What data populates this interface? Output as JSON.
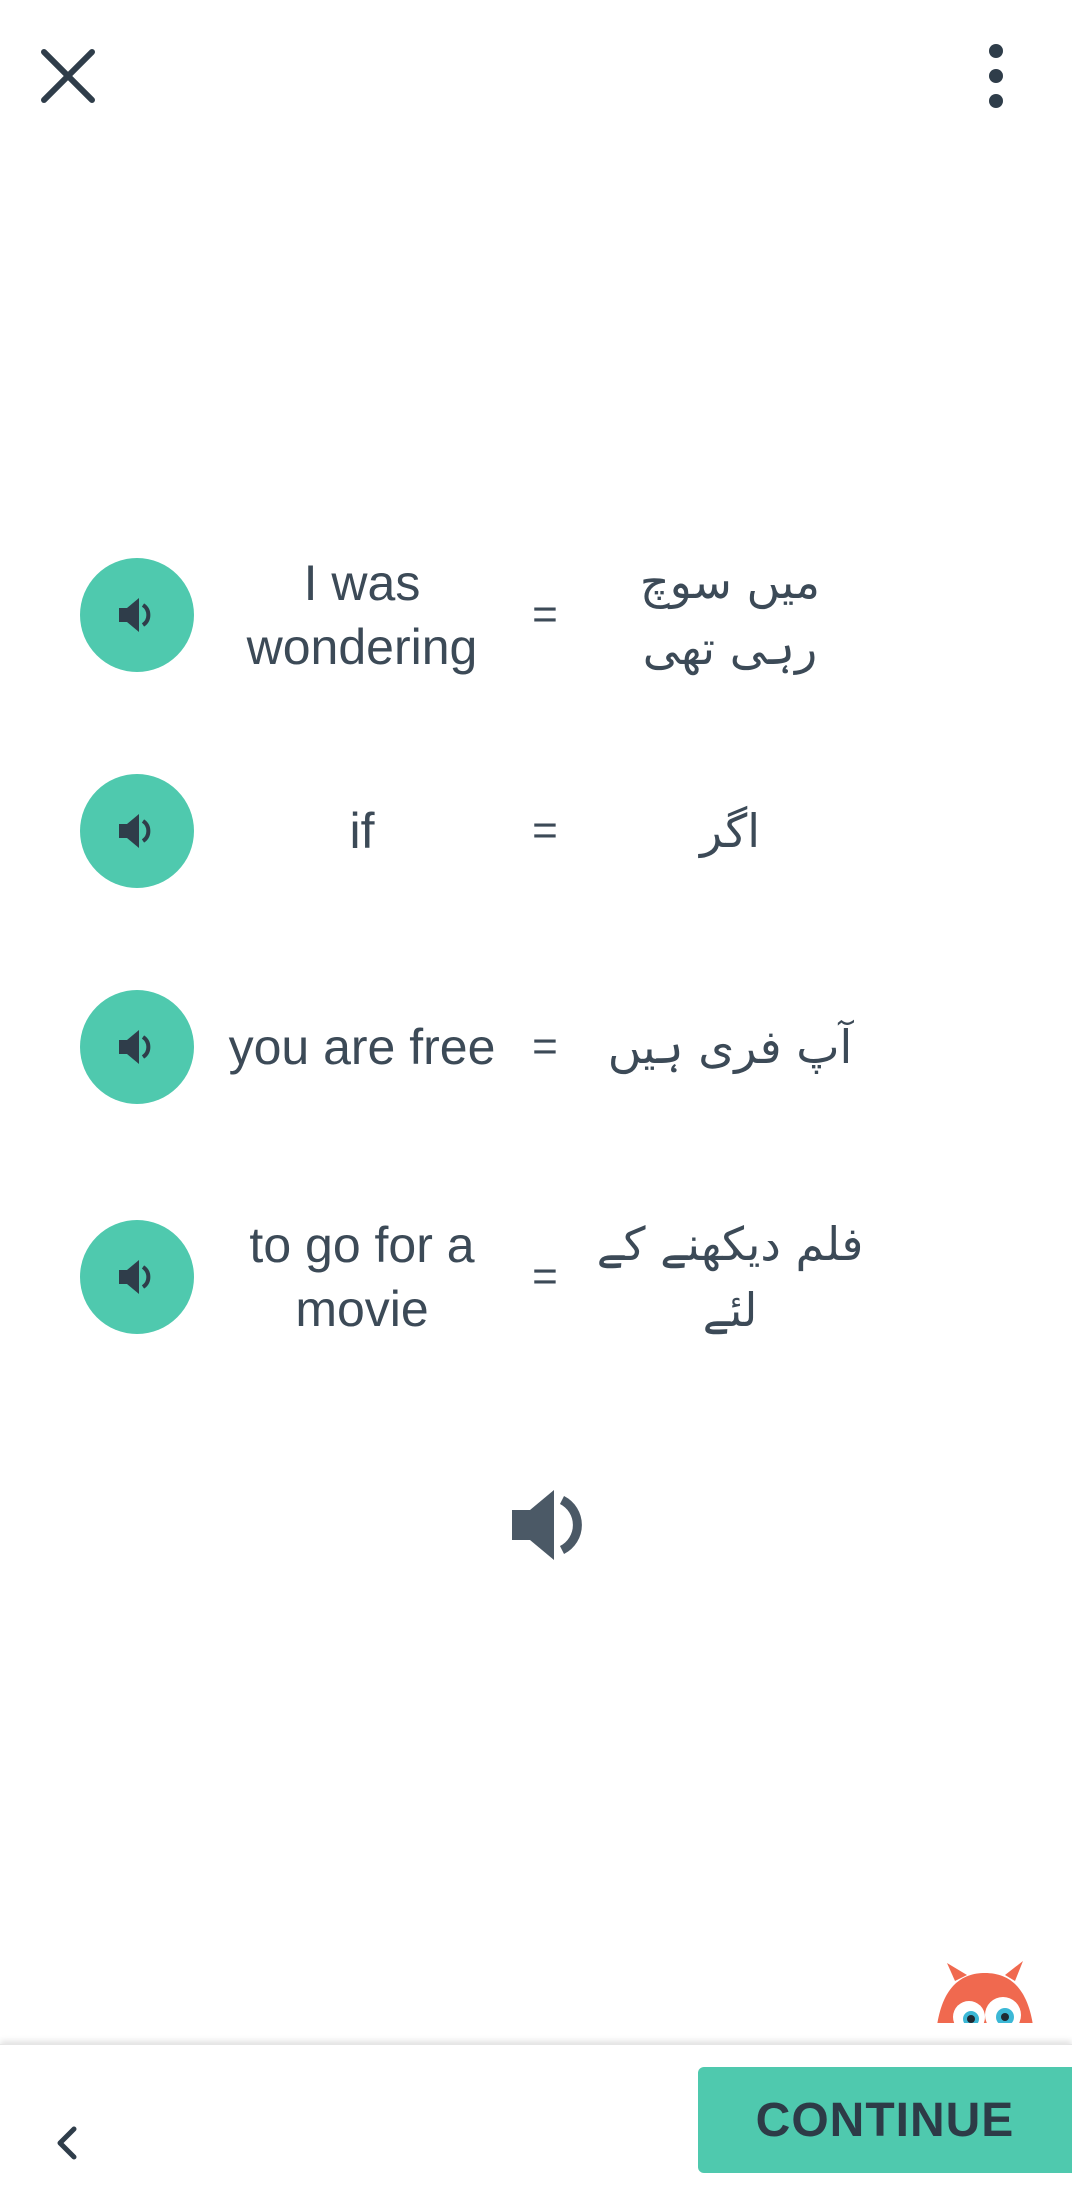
{
  "header": {
    "close_icon": "close-icon",
    "more_icon": "more-vertical-icon"
  },
  "phrases": [
    {
      "english": "I was wondering",
      "equals": "=",
      "urdu": "میں سوچ رہی تھی",
      "icon": "speaker-icon"
    },
    {
      "english": "if",
      "equals": "=",
      "urdu": "اگر",
      "icon": "speaker-icon"
    },
    {
      "english": "you are free",
      "equals": "=",
      "urdu": "آپ فری ہیں",
      "icon": "speaker-icon"
    },
    {
      "english": "to go for a movie",
      "equals": "=",
      "urdu": "فلم دیکھنے کے لئے",
      "icon": "speaker-icon"
    }
  ],
  "play_all_icon": "speaker-icon",
  "footer": {
    "back_icon": "chevron-left-icon",
    "continue_label": "CONTINUE"
  },
  "colors": {
    "accent": "#4fc9ae",
    "text": "#3c4a57",
    "mascot": "#f0694f"
  }
}
